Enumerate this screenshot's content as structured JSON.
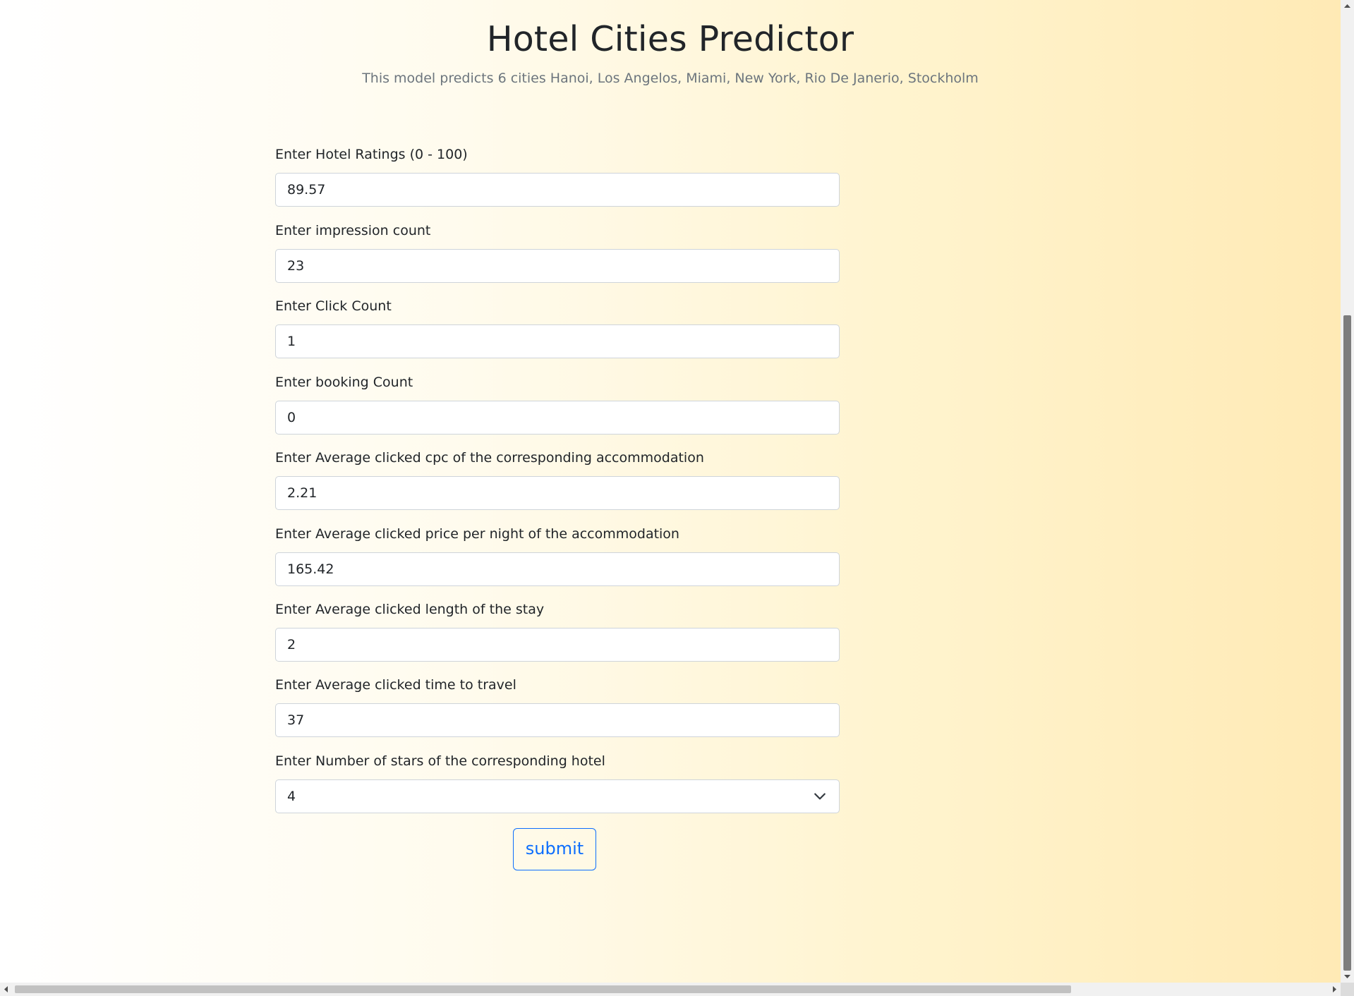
{
  "header": {
    "title": "Hotel Cities Predictor",
    "subtitle": "This model predicts 6 cities Hanoi, Los Angelos, Miami, New York, Rio De Janerio, Stockholm"
  },
  "form": {
    "fields": [
      {
        "label": "Enter Hotel Ratings (0 - 100)",
        "value": "89.57"
      },
      {
        "label": "Enter impression count",
        "value": "23"
      },
      {
        "label": "Enter Click Count",
        "value": "1"
      },
      {
        "label": "Enter booking Count",
        "value": "0"
      },
      {
        "label": "Enter Average clicked cpc of the corresponding accommodation",
        "value": "2.21"
      },
      {
        "label": "Enter Average clicked price per night of the accommodation",
        "value": "165.42"
      },
      {
        "label": "Enter Average clicked length of the stay",
        "value": "2"
      },
      {
        "label": "Enter Average clicked time to travel",
        "value": "37"
      }
    ],
    "stars": {
      "label": "Enter Number of stars of the corresponding hotel",
      "selected": "4"
    },
    "submit_label": "submit"
  },
  "colors": {
    "accent": "#0d6efd",
    "text": "#212529",
    "muted": "#6c757d",
    "background_end": "#ffeab5"
  }
}
